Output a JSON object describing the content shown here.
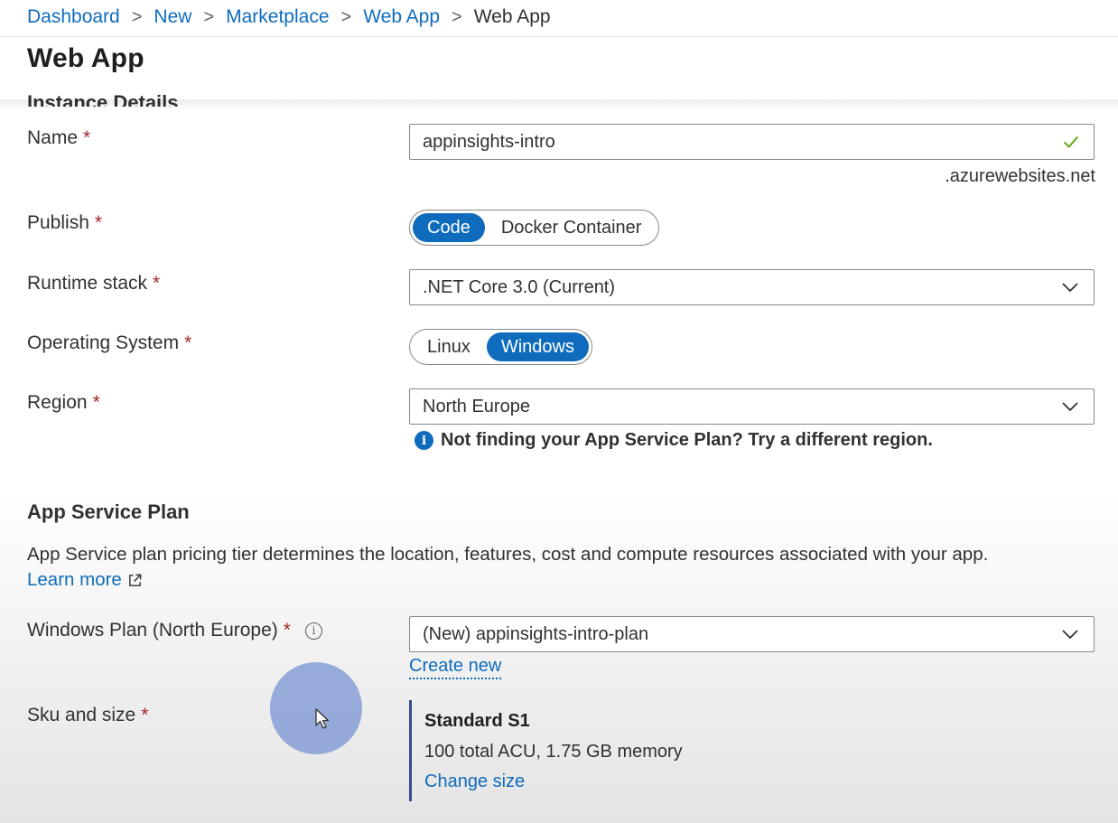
{
  "breadcrumb": {
    "items": [
      "Dashboard",
      "New",
      "Marketplace",
      "Web App"
    ],
    "current": "Web App",
    "separator": ">"
  },
  "page_title": "Web App",
  "instance_section_title": "Instance Details",
  "form": {
    "name": {
      "label": "Name",
      "required": "*",
      "value": "appinsights-intro",
      "suffix": ".azurewebsites.net",
      "valid_icon": "checkmark-icon"
    },
    "publish": {
      "label": "Publish",
      "required": "*",
      "options": [
        "Code",
        "Docker Container"
      ],
      "selected": "Code"
    },
    "runtime_stack": {
      "label": "Runtime stack",
      "required": "*",
      "value": ".NET Core 3.0 (Current)"
    },
    "operating_system": {
      "label": "Operating System",
      "required": "*",
      "options": [
        "Linux",
        "Windows"
      ],
      "selected": "Windows"
    },
    "region": {
      "label": "Region",
      "required": "*",
      "value": "North Europe",
      "info": "Not finding your App Service Plan? Try a different region.",
      "info_icon": "i"
    }
  },
  "app_service_plan": {
    "title": "App Service Plan",
    "description": "App Service plan pricing tier determines the location, features, cost and compute resources associated with your app.",
    "learn_more": "Learn more",
    "windows_plan": {
      "label": "Windows Plan (North Europe)",
      "required": "*",
      "info_icon": "i",
      "value": "(New) appinsights-intro-plan",
      "create_new": "Create new"
    },
    "sku": {
      "label": "Sku and size",
      "required": "*",
      "name": "Standard S1",
      "detail": "100 total ACU, 1.75 GB memory",
      "change_link": "Change size"
    }
  },
  "colors": {
    "accent": "#0f6cbd",
    "required": "#a4262c",
    "valid": "#57a300",
    "sku_bar": "#3a4a8f"
  }
}
